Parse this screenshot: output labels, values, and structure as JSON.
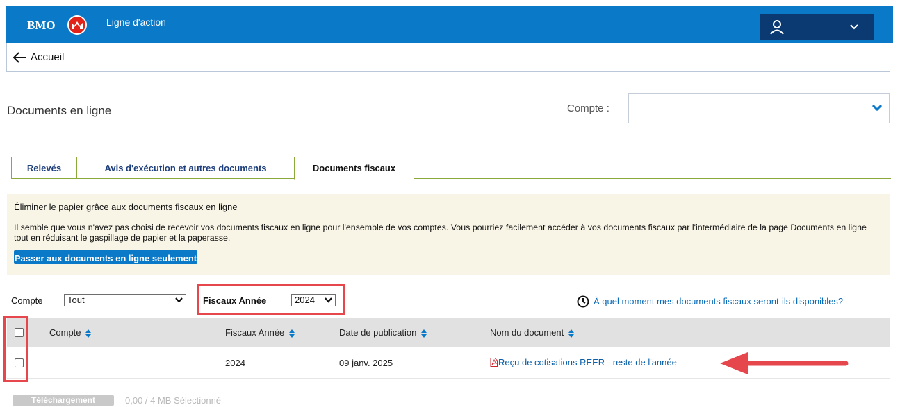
{
  "header": {
    "brand": "BMO",
    "app_name": "Ligne d'action"
  },
  "breadcrumb": {
    "label": "Accueil"
  },
  "page": {
    "title": "Documents en ligne",
    "account_label": "Compte :",
    "account_value": ""
  },
  "tabs": [
    {
      "label": "Relevés",
      "active": false
    },
    {
      "label": "Avis d'exécution et autres documents",
      "active": false
    },
    {
      "label": "Documents fiscaux",
      "active": true
    }
  ],
  "notice": {
    "title": "Éliminer le papier grâce aux documents fiscaux en ligne",
    "body": "Il semble que vous n'avez pas choisi de recevoir vos documents fiscaux en ligne pour l'ensemble de vos comptes. Vous pourriez facilement accéder à vos documents fiscaux par l'intermédiaire de la page Documents en ligne tout en réduisant le gaspillage de papier et la paperasse.",
    "cta": "Passer aux documents en ligne seulement"
  },
  "filters": {
    "account_label": "Compte",
    "account_value": "Tout",
    "year_label": "Fiscaux Année",
    "year_value": "2024"
  },
  "help_link": "À quel moment mes documents fiscaux seront-ils disponibles?",
  "table": {
    "columns": [
      "Compte",
      "Fiscaux Année",
      "Date de publication",
      "Nom du document"
    ],
    "rows": [
      {
        "account": "",
        "year": "2024",
        "date": "09 janv. 2025",
        "document": "Reçu de cotisations REER - reste de l'année"
      }
    ]
  },
  "footer": {
    "download_label": "Téléchargement",
    "selection_info": "0,00 / 4 MB Sélectionné"
  },
  "colors": {
    "brand_blue": "#0a79c8",
    "brand_red": "#e2231a",
    "user_menu": "#0b3a72",
    "tab_border": "#8aa93a",
    "notice_bg": "#f8f5e6",
    "highlight": "#e5474c",
    "link": "#0a5fa8"
  }
}
